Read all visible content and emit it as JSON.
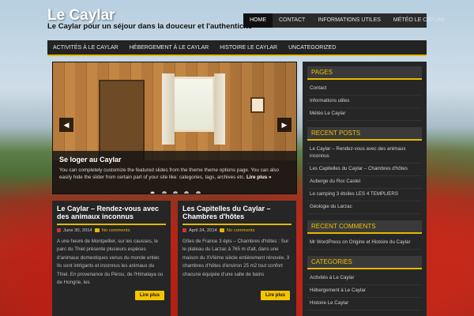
{
  "site": {
    "title": "Le Caylar",
    "tagline": "Le Caylar pour un séjour dans la douceur et l'authenticité"
  },
  "top_nav": [
    "HOME",
    "CONTACT",
    "INFORMATIONS UTILES",
    "MÉTÉO LE CAYLAR"
  ],
  "main_nav": [
    "ACTIVITÉS À LE CAYLAR",
    "HÉBERGEMENT À LE CAYLAR",
    "HISTOIRE LE CAYLAR",
    "UNCATEGORIZED"
  ],
  "slider": {
    "title": "Se loger au Caylar",
    "text": "You can completely customize the featured slides from the theme theme options page. You can also easily hide the slider from certain part of your site like: categories, tags, archives etc.",
    "more": "Lire plus »",
    "dots": 5,
    "active_dot": 0
  },
  "posts": [
    {
      "title": "Le Caylar – Rendez-vous avec des animaux inconnus",
      "date": "June 30, 2014",
      "comments": "No comments",
      "excerpt": "A une heure de Montpellier, sur les causses, le parc du Thiel présente plusieurs espèces d'animaux domestiques venus du monde entier. Ils sont intrigants et inconnus les animaux du Thiel. En provenance du Pérou, de l'Himalaya ou de Hongrie, les",
      "readmore": "Lire plus"
    },
    {
      "title": "Les Capitelles du Caylar – Chambres d'hôtes",
      "date": "April 24, 2014",
      "comments": "No comments",
      "excerpt": "Gîtes de France 3 épis – Chambres d'hôtes : Sur le plateau du Larzac à 765 m d'alt, dans une maison du XVIème siècle entièrement rénovée, 3 chambres d'hôtes d'environ 25 m2 tout confort chacune équipée d'une salle de bains",
      "readmore": "Lire plus"
    }
  ],
  "sidebar": {
    "pages": {
      "heading": "PAGES",
      "items": [
        "Contact",
        "Informations utiles",
        "Météo Le Caylar"
      ]
    },
    "recent_posts": {
      "heading": "RECENT POSTS",
      "items": [
        "Le Caylar – Rendez-vous avec des animaux inconnus",
        "Les Capitelles du Caylar – Chambres d'hôtes",
        "Auberge du Roc Castel",
        "Le camping 3 étoiles LES 4 TEMPLIERS",
        "Géologie du Larzac"
      ]
    },
    "recent_comments": {
      "heading": "RECENT COMMENTS",
      "author": "Mr WordPress",
      "on": "on",
      "post": "Origine et Histoire du Caylar"
    },
    "categories": {
      "heading": "CATEGORIES",
      "items": [
        "Activités à Le Caylar",
        "Hébergement à Le Caylar",
        "Histoire Le Caylar"
      ]
    }
  }
}
